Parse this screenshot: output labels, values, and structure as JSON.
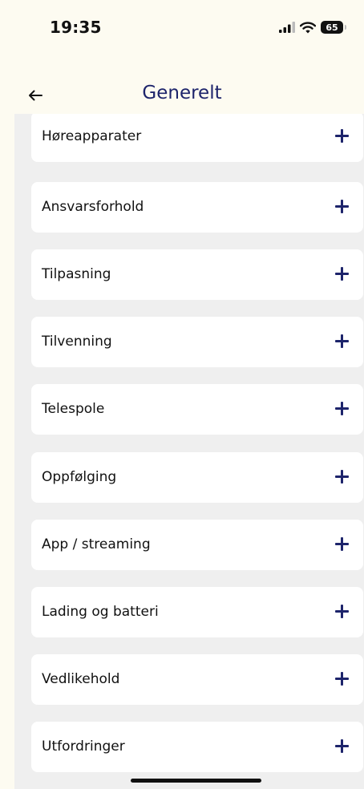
{
  "status_bar": {
    "time": "19:35",
    "battery": "65",
    "icons": [
      "signal-icon",
      "wifi-icon",
      "battery-icon"
    ]
  },
  "header": {
    "title": "Generelt",
    "back_icon": "arrow-left-icon"
  },
  "colors": {
    "accent": "#1d246b",
    "page_background": "#fdfbf1",
    "list_background": "#efefef",
    "card_background": "#ffffff"
  },
  "items": [
    {
      "label": "Høreapparater",
      "icon": "plus-icon"
    },
    {
      "label": "Ansvarsforhold",
      "icon": "plus-icon"
    },
    {
      "label": "Tilpasning",
      "icon": "plus-icon"
    },
    {
      "label": "Tilvenning",
      "icon": "plus-icon"
    },
    {
      "label": "Telespole",
      "icon": "plus-icon"
    },
    {
      "label": "Oppfølging",
      "icon": "plus-icon"
    },
    {
      "label": "App / streaming",
      "icon": "plus-icon"
    },
    {
      "label": "Lading og batteri",
      "icon": "plus-icon"
    },
    {
      "label": "Vedlikehold",
      "icon": "plus-icon"
    },
    {
      "label": "Utfordringer",
      "icon": "plus-icon"
    }
  ]
}
